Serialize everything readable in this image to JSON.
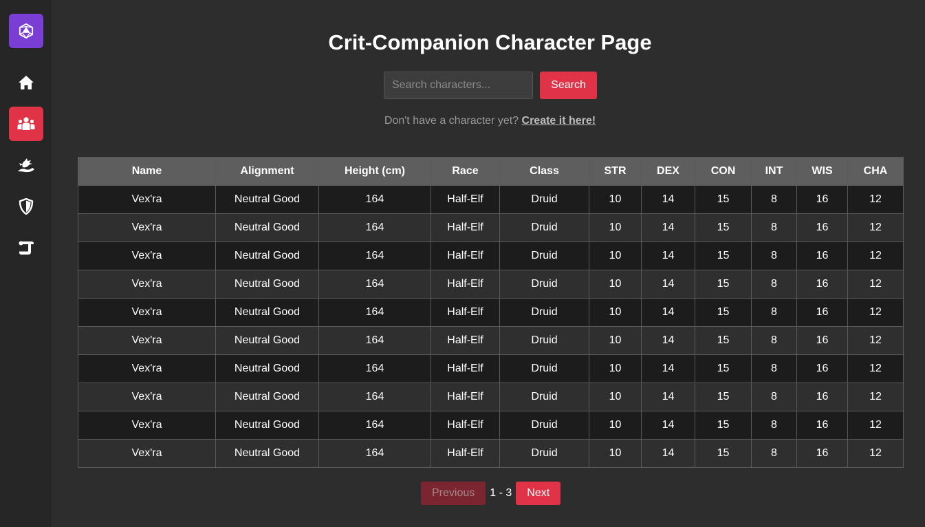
{
  "sidebar": {
    "logo_icon": "d20-dice-icon",
    "items": [
      {
        "icon": "home-icon",
        "active": false
      },
      {
        "icon": "users-icon",
        "active": true
      },
      {
        "icon": "dragon-icon",
        "active": false
      },
      {
        "icon": "shield-icon",
        "active": false
      },
      {
        "icon": "scroll-icon",
        "active": false
      }
    ]
  },
  "header": {
    "title": "Crit-Companion Character Page"
  },
  "search": {
    "placeholder": "Search characters...",
    "button_label": "Search"
  },
  "create": {
    "prompt": "Don't have a character yet?",
    "link_label": "Create it here!"
  },
  "table": {
    "columns": [
      "Name",
      "Alignment",
      "Height (cm)",
      "Race",
      "Class",
      "STR",
      "DEX",
      "CON",
      "INT",
      "WIS",
      "CHA"
    ],
    "rows": [
      [
        "Vex'ra",
        "Neutral Good",
        "164",
        "Half-Elf",
        "Druid",
        "10",
        "14",
        "15",
        "8",
        "16",
        "12"
      ],
      [
        "Vex'ra",
        "Neutral Good",
        "164",
        "Half-Elf",
        "Druid",
        "10",
        "14",
        "15",
        "8",
        "16",
        "12"
      ],
      [
        "Vex'ra",
        "Neutral Good",
        "164",
        "Half-Elf",
        "Druid",
        "10",
        "14",
        "15",
        "8",
        "16",
        "12"
      ],
      [
        "Vex'ra",
        "Neutral Good",
        "164",
        "Half-Elf",
        "Druid",
        "10",
        "14",
        "15",
        "8",
        "16",
        "12"
      ],
      [
        "Vex'ra",
        "Neutral Good",
        "164",
        "Half-Elf",
        "Druid",
        "10",
        "14",
        "15",
        "8",
        "16",
        "12"
      ],
      [
        "Vex'ra",
        "Neutral Good",
        "164",
        "Half-Elf",
        "Druid",
        "10",
        "14",
        "15",
        "8",
        "16",
        "12"
      ],
      [
        "Vex'ra",
        "Neutral Good",
        "164",
        "Half-Elf",
        "Druid",
        "10",
        "14",
        "15",
        "8",
        "16",
        "12"
      ],
      [
        "Vex'ra",
        "Neutral Good",
        "164",
        "Half-Elf",
        "Druid",
        "10",
        "14",
        "15",
        "8",
        "16",
        "12"
      ],
      [
        "Vex'ra",
        "Neutral Good",
        "164",
        "Half-Elf",
        "Druid",
        "10",
        "14",
        "15",
        "8",
        "16",
        "12"
      ],
      [
        "Vex'ra",
        "Neutral Good",
        "164",
        "Half-Elf",
        "Druid",
        "10",
        "14",
        "15",
        "8",
        "16",
        "12"
      ]
    ]
  },
  "pagination": {
    "previous_label": "Previous",
    "page_indicator": "1 - 3",
    "next_label": "Next",
    "previous_disabled": true
  },
  "colors": {
    "accent": "#e03347",
    "logo_bg": "#7a3ed4",
    "background": "#2d2d2d",
    "sidebar_bg": "#262626"
  }
}
